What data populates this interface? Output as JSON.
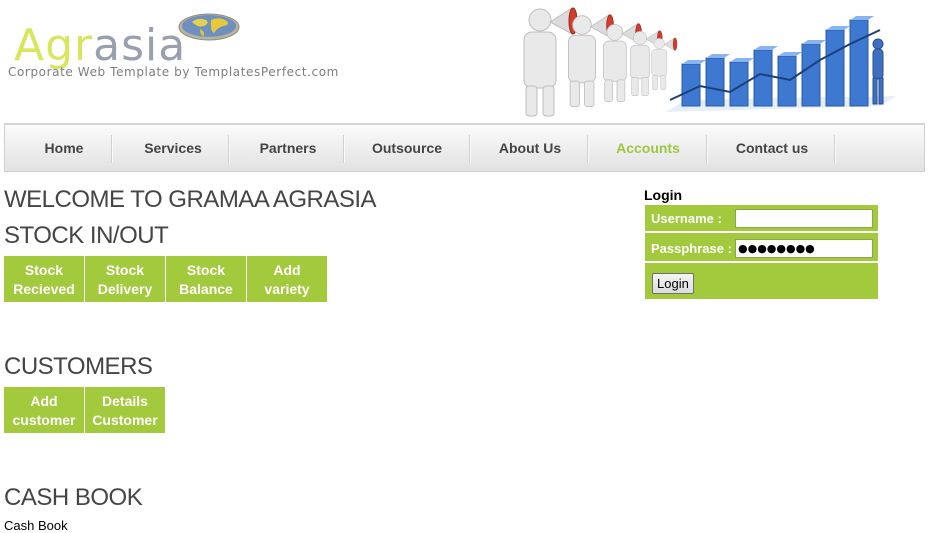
{
  "header": {
    "logo_part1": "Agr",
    "logo_part2": "asia",
    "tagline": "Corporate Web Template by TemplatesPerfect.com"
  },
  "nav": {
    "items": [
      {
        "label": "Home"
      },
      {
        "label": "Services"
      },
      {
        "label": "Partners"
      },
      {
        "label": "Outsource"
      },
      {
        "label": "About Us"
      },
      {
        "label": "Accounts",
        "active": true
      },
      {
        "label": "Contact us"
      }
    ]
  },
  "main": {
    "welcome": "WELCOME TO GRAMAA AGRASIA",
    "stock": {
      "heading": "STOCK IN/OUT",
      "buttons": [
        {
          "line1": "Stock",
          "line2": "Recieved"
        },
        {
          "line1": "Stock",
          "line2": "Delivery"
        },
        {
          "line1": "Stock",
          "line2": "Balance"
        },
        {
          "line1": "Add",
          "line2": "variety"
        }
      ]
    },
    "customers": {
      "heading": "CUSTOMERS",
      "buttons": [
        {
          "line1": "Add",
          "line2": "customer"
        },
        {
          "line1": "Details",
          "line2": "Customer"
        }
      ]
    },
    "cashbook": {
      "heading": "CASH BOOK",
      "text": "Cash Book"
    }
  },
  "login": {
    "title": "Login",
    "username_label": "Username   :",
    "username_value": "",
    "password_label": "Passphrase :",
    "password_value": "●●●●●●●●",
    "button_label": "Login"
  },
  "colors": {
    "accent_green": "#a3c93c",
    "nav_active": "#9ec740",
    "heading_gray": "#454545"
  },
  "icons": [
    "globe-icon",
    "megaphone-people-illustration",
    "bar-chart-illustration"
  ]
}
